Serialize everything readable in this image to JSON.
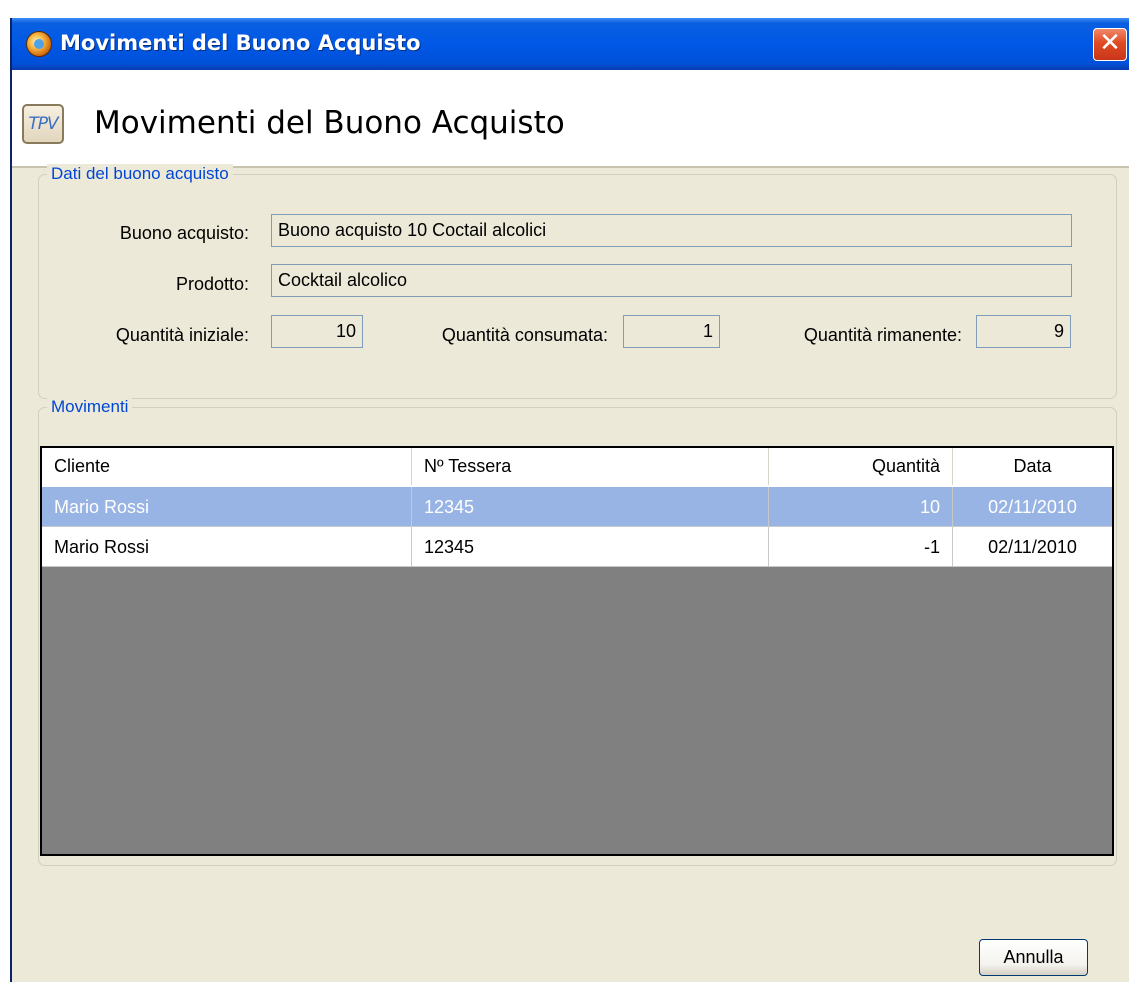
{
  "window": {
    "title": "Movimenti del Buono Acquisto",
    "close_glyph": "✕"
  },
  "header": {
    "icon_text": "TPV",
    "title": "Movimenti del Buono Acquisto"
  },
  "dati": {
    "legend": "Dati del buono acquisto",
    "buono_label": "Buono acquisto:",
    "buono_value": "Buono acquisto 10 Coctail alcolici",
    "prodotto_label": "Prodotto:",
    "prodotto_value": "Cocktail alcolico",
    "iniziale_label": "Quantità iniziale:",
    "iniziale_value": "10",
    "consumata_label": "Quantità consumata:",
    "consumata_value": "1",
    "rimanente_label": "Quantità rimanente:",
    "rimanente_value": "9"
  },
  "movimenti": {
    "legend": "Movimenti",
    "columns": [
      "Cliente",
      "Nº Tessera",
      "Quantità",
      "Data"
    ],
    "rows": [
      {
        "cliente": "Mario Rossi",
        "tessera": "12345",
        "quantita": "10",
        "data": "02/11/2010",
        "selected": true
      },
      {
        "cliente": "Mario Rossi",
        "tessera": "12345",
        "quantita": "-1",
        "data": "02/11/2010",
        "selected": false
      }
    ]
  },
  "footer": {
    "cancel_label": "Annulla"
  },
  "colors": {
    "titlebar": "#0058e6",
    "dialog_bg": "#ece9d8",
    "selected_row": "#98b4e4",
    "group_legend": "#0046d5"
  }
}
